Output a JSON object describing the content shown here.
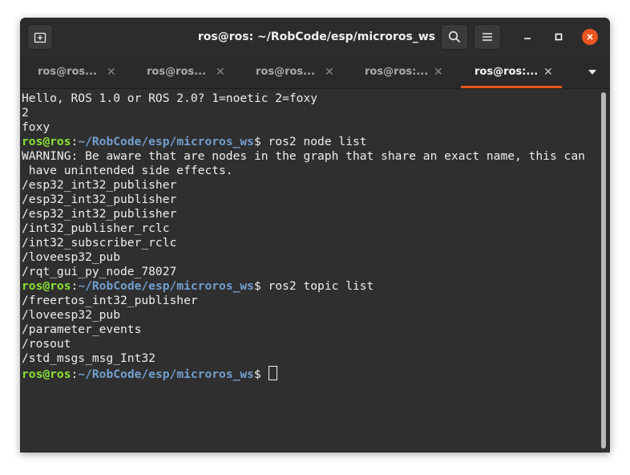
{
  "window": {
    "title": "ros@ros: ~/RobCode/esp/microros_ws",
    "accent_color": "#e95420"
  },
  "header_icons": {
    "new_tab": "new-tab-icon",
    "search": "search-icon",
    "menu": "hamburger-menu-icon",
    "minimize": "minimize-icon",
    "maximize": "maximize-icon",
    "close": "close-icon"
  },
  "tabs": [
    {
      "label": "ros@ros: ~/RobCode/esp/microros_ws",
      "display": "ros@ros...",
      "close": "✕",
      "active": false
    },
    {
      "label": "ros@ros: ~/RobCode/esp/microros_ws",
      "display": "ros@ros...",
      "close": "✕",
      "active": false
    },
    {
      "label": "ros@ros: ~/RobCode/esp/microros_ws",
      "display": "ros@ros...",
      "close": "✕",
      "active": false
    },
    {
      "label": "ros@ros: ~/RobCode/esp/microros_ws",
      "display": "ros@ros:...",
      "close": "✕",
      "active": false
    },
    {
      "label": "ros@ros: ~/RobCode/esp/microros_ws",
      "display": "ros@ros:...",
      "close": "✕",
      "active": true
    }
  ],
  "prompt": {
    "user": "ros@ros",
    "colon": ":",
    "path": "~/RobCode/esp/microros_ws",
    "symbol": "$ "
  },
  "terminal": {
    "lines": [
      {
        "text": "Hello, ROS 1.0 or ROS 2.0? 1=noetic 2=foxy"
      },
      {
        "text": "2"
      },
      {
        "text": "foxy"
      },
      {
        "prompt": true,
        "command": "ros2 node list"
      },
      {
        "text": "WARNING: Be aware that are nodes in the graph that share an exact name, this can"
      },
      {
        "text": " have unintended side effects."
      },
      {
        "text": "/esp32_int32_publisher"
      },
      {
        "text": "/esp32_int32_publisher"
      },
      {
        "text": "/esp32_int32_publisher"
      },
      {
        "text": "/int32_publisher_rclc"
      },
      {
        "text": "/int32_subscriber_rclc"
      },
      {
        "text": "/loveesp32_pub"
      },
      {
        "text": "/rqt_gui_py_node_78027"
      },
      {
        "prompt": true,
        "command": "ros2 topic list"
      },
      {
        "text": "/freertos_int32_publisher"
      },
      {
        "text": "/loveesp32_pub"
      },
      {
        "text": "/parameter_events"
      },
      {
        "text": "/rosout"
      },
      {
        "text": "/std_msgs_msg_Int32"
      },
      {
        "prompt": true,
        "command": "",
        "cursor": true
      }
    ]
  }
}
